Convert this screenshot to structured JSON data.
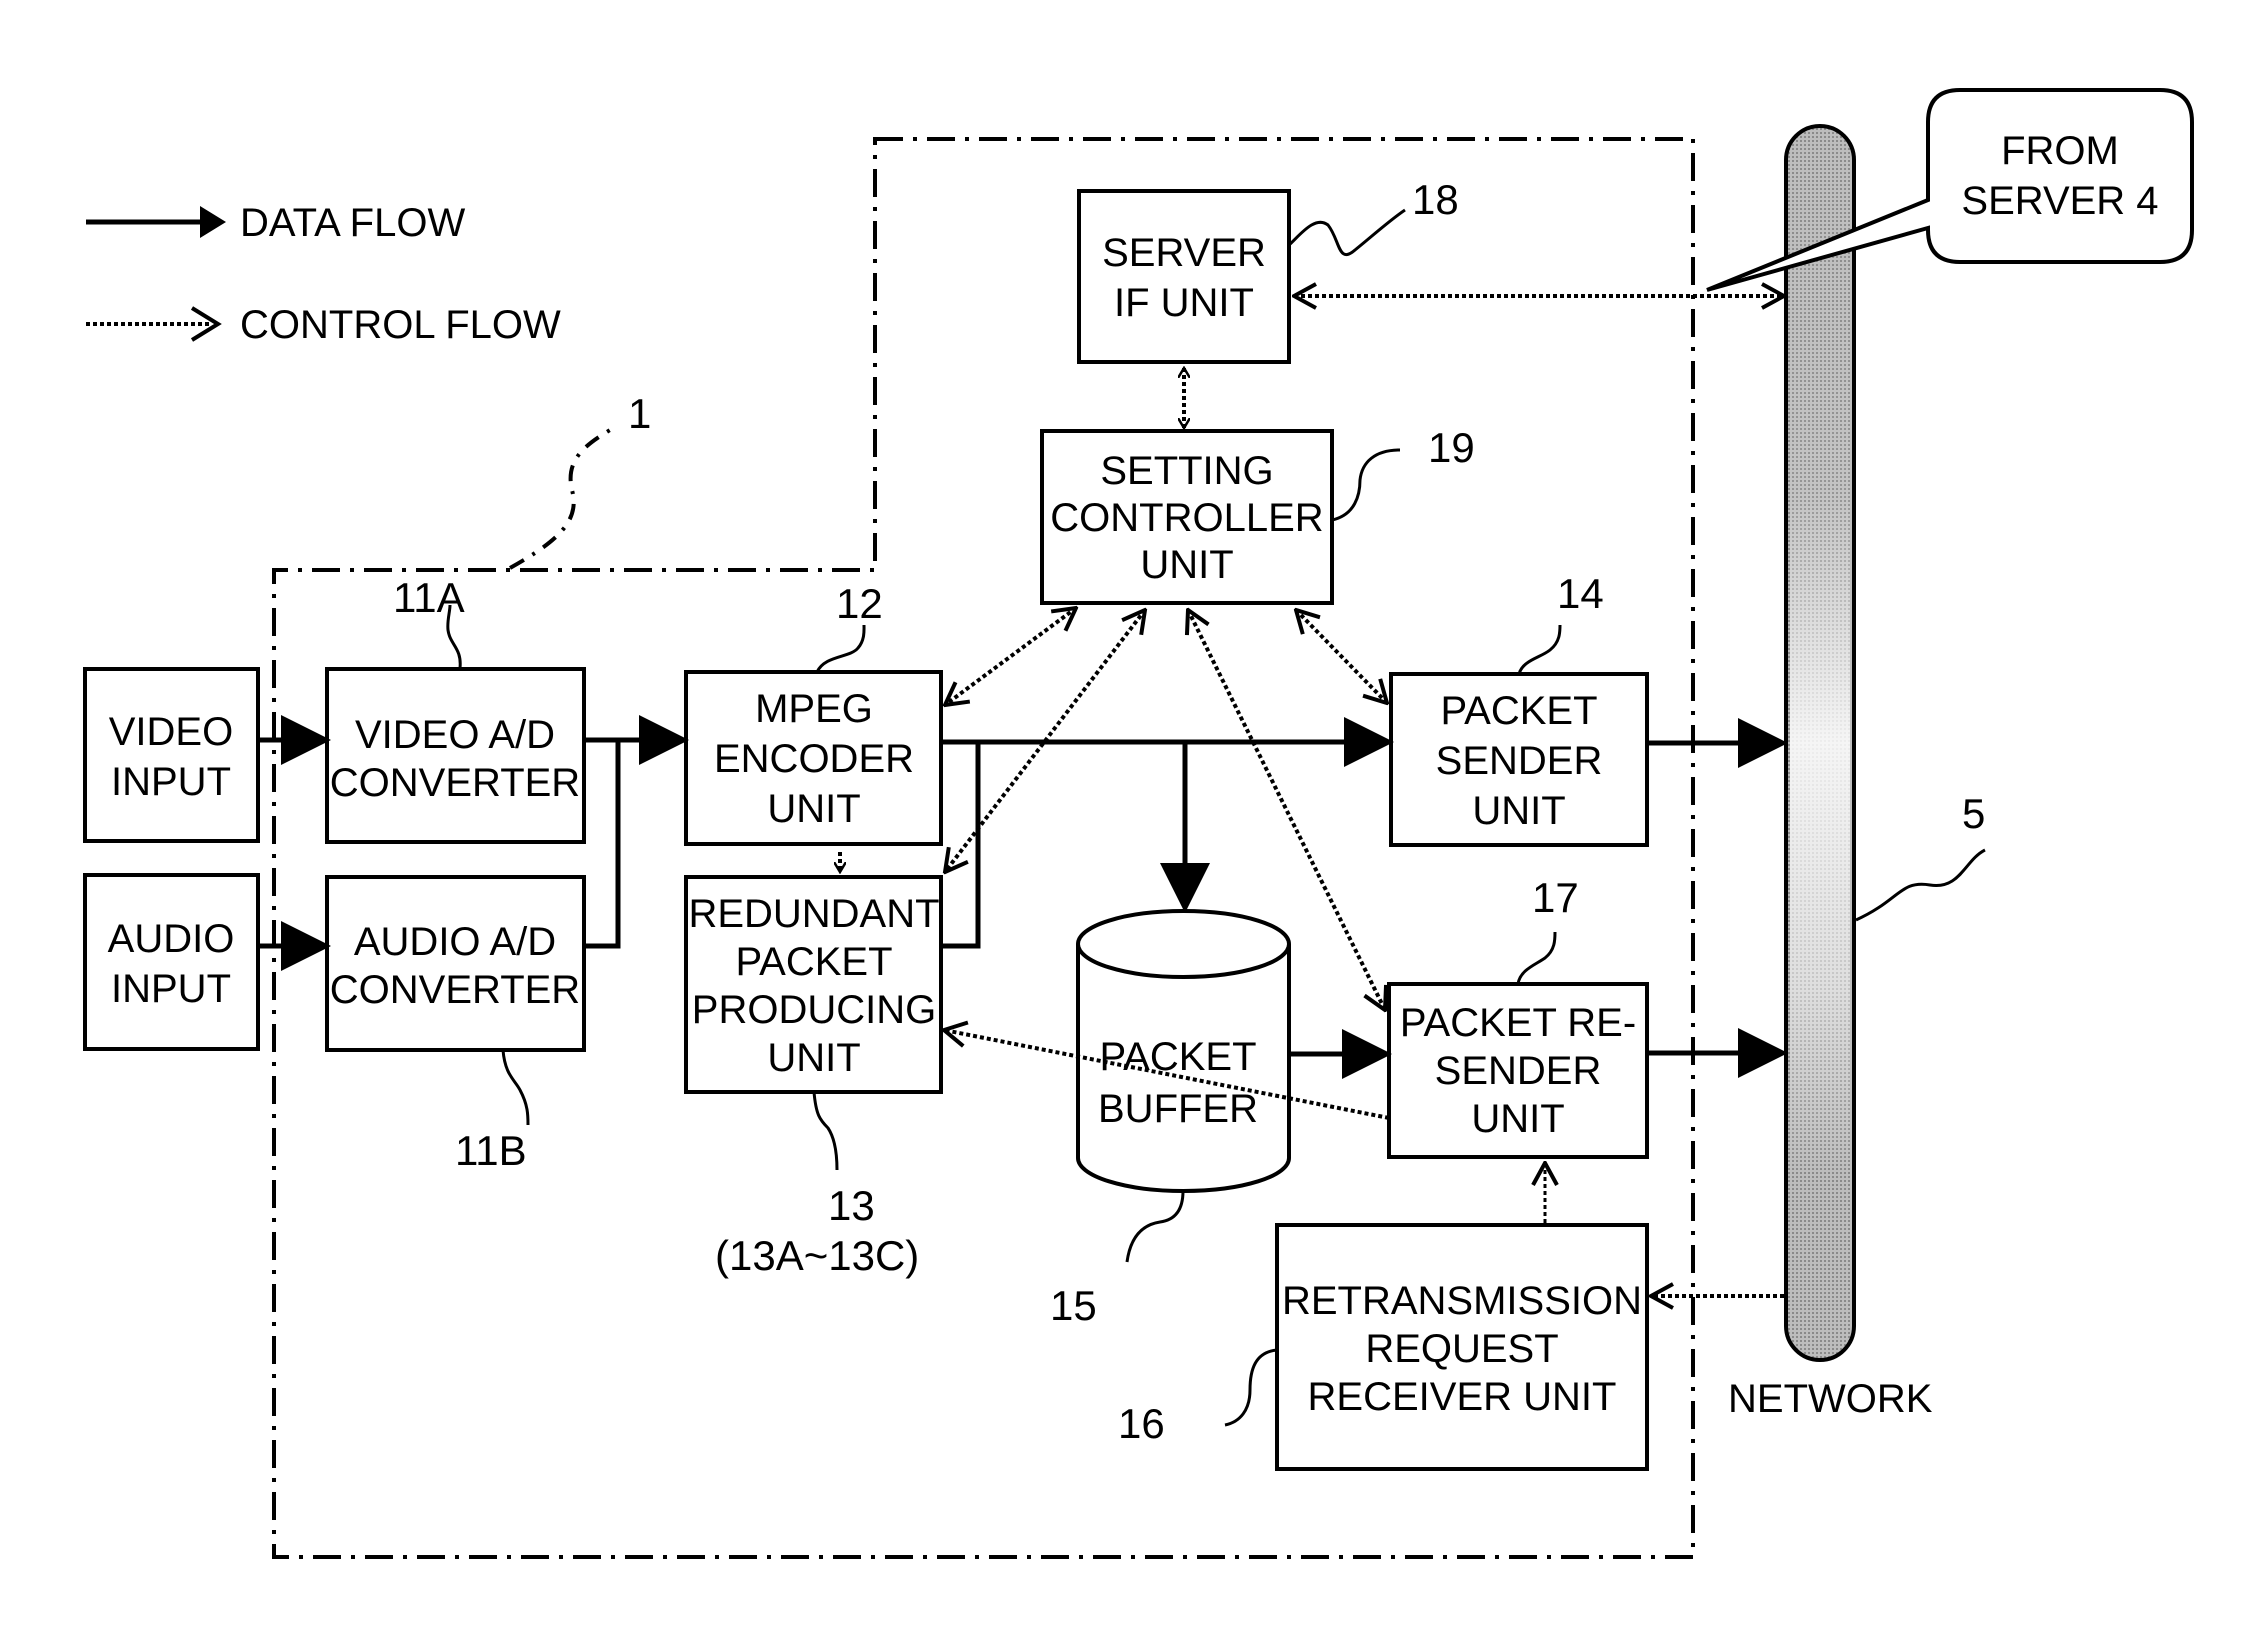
{
  "legend": {
    "data_flow": "DATA FLOW",
    "control_flow": "CONTROL FLOW"
  },
  "blocks": {
    "video_input": [
      "VIDEO",
      "INPUT"
    ],
    "audio_input": [
      "AUDIO",
      "INPUT"
    ],
    "video_ad": [
      "VIDEO A/D",
      "CONVERTER"
    ],
    "audio_ad": [
      "AUDIO A/D",
      "CONVERTER"
    ],
    "mpeg": [
      "MPEG",
      "ENCODER",
      "UNIT"
    ],
    "redundant": [
      "REDUNDANT",
      "PACKET",
      "PRODUCING",
      "UNIT"
    ],
    "server_if": [
      "SERVER",
      "IF UNIT"
    ],
    "setting": [
      "SETTING",
      "CONTROLLER",
      "UNIT"
    ],
    "packet_sender": [
      "PACKET",
      "SENDER",
      "UNIT"
    ],
    "packet_resender": [
      "PACKET RE-",
      "SENDER",
      "UNIT"
    ],
    "retransmission": [
      "RETRANSMISSION",
      "REQUEST",
      "RECEIVER UNIT"
    ],
    "packet_buffer": [
      "PACKET",
      "BUFFER"
    ]
  },
  "callout": [
    "FROM",
    "SERVER 4"
  ],
  "network_label": "NETWORK",
  "refs": {
    "device": "1",
    "video_ad": "11A",
    "audio_ad": "11B",
    "mpeg": "12",
    "redundant": "13",
    "redundant_sub": "(13A~13C)",
    "packet_sender": "14",
    "packet_buffer": "15",
    "retransmission": "16",
    "packet_resender": "17",
    "server_if": "18",
    "setting": "19",
    "network": "5"
  }
}
